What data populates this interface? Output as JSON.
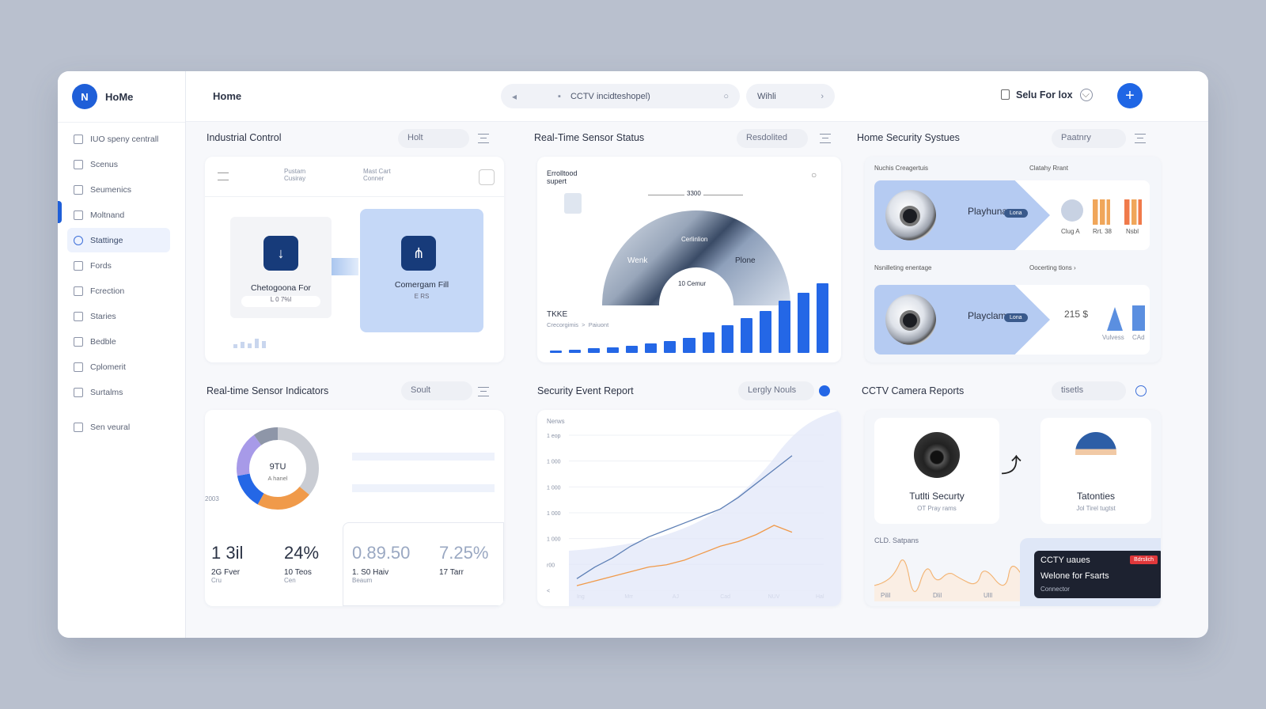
{
  "app": {
    "brand": "HoMe",
    "page_title": "Home"
  },
  "topbar": {
    "search_text": "CCTV incidteshopel)",
    "pill_text": "Wihli",
    "user_name": "Selu For lox"
  },
  "sidebar": {
    "items": [
      {
        "label": "IUO speny centrall",
        "icon": "layout-icon"
      },
      {
        "label": "Scenus",
        "icon": "list-icon"
      },
      {
        "label": "Seumenics",
        "icon": "folder-icon"
      },
      {
        "label": "Moltnand",
        "icon": "monitor-icon"
      },
      {
        "label": "Stattinge",
        "icon": "settings-icon"
      },
      {
        "label": "Fords",
        "icon": "file-icon"
      },
      {
        "label": "Fcrection",
        "icon": "grid-icon"
      },
      {
        "label": "Staries",
        "icon": "chart-icon"
      },
      {
        "label": "Bedble",
        "icon": "circle-icon"
      },
      {
        "label": "Cplomerit",
        "icon": "mail-icon"
      },
      {
        "label": "Surtalms",
        "icon": "doc-icon"
      },
      {
        "label": "Sen veural",
        "icon": "book-icon"
      }
    ]
  },
  "industrial": {
    "title": "Industrial Control",
    "pill": "Holt",
    "tab1_a": "Pustam",
    "tab1_b": "Cusiray",
    "tab2_a": "Mast Cart",
    "tab2_b": "Conner",
    "tile1_label": "Chetogoona For",
    "tile1_value": "L 0 7%l",
    "tile2_label": "Comergam Fill",
    "tile2_value": "E RS"
  },
  "sensor_status": {
    "title": "Real-Time Sensor Status",
    "pill": "Resdolited",
    "sub_a": "Errolltood",
    "sub_b": "supert",
    "gauge_top": "3300",
    "gauge_left": "Wenk",
    "gauge_right": "Plone",
    "gauge_center": "Cerlinlion",
    "gauge_inner": "10 Cemur",
    "bottom_title": "TKKE",
    "bottom_sub_a": "Crecorgimis",
    "bottom_sub_b": "Paiuont",
    "bars": [
      2,
      3,
      4,
      5,
      6,
      8,
      10,
      13,
      18,
      24,
      30,
      36,
      45,
      52,
      60
    ]
  },
  "home_security": {
    "title": "Home Security Systues",
    "pill": "Paatnry",
    "left_label": "Nuchis Creagertuis",
    "right_label": "Clatahy Rrant",
    "row1_name": "Playhuna",
    "row1_badge": "Lona",
    "thumb1": "Clug A",
    "thumb2": "Rrt. 38",
    "thumb3": "Nsbl",
    "mid_left": "Nsnilleting enentage",
    "mid_right": "Oocerting tlons",
    "row2_name": "Playclam",
    "row2_badge": "Lona",
    "stat_value": "215 $",
    "stat_sub": "",
    "thumb4": "Vulvess",
    "thumb5": "CAd"
  },
  "sensor_indicators": {
    "title": "Real-time Sensor Indicators",
    "pill": "Soult",
    "donut_value": "9TU",
    "donut_sub": "A hanel",
    "donut_axis": "2003",
    "donut_segments": [
      {
        "value": 36,
        "color": "#c9ccd3"
      },
      {
        "value": 22,
        "color": "#f09a4a"
      },
      {
        "value": 14,
        "color": "#2467e6"
      },
      {
        "value": 18,
        "color": "#a79ae8"
      },
      {
        "value": 10,
        "color": "#8e96a8"
      }
    ],
    "stats": [
      {
        "value": "1 3il",
        "label": "2G Fver",
        "sub": "Cru"
      },
      {
        "value": "24%",
        "label": "10 Teos",
        "sub": "Cen"
      },
      {
        "value": "0.89.50",
        "label": "1. S0 Haiv",
        "sub": "Beaum"
      },
      {
        "value": "7.25%",
        "label": "17 Tarr",
        "sub": ""
      }
    ]
  },
  "security_report": {
    "title": "Security Event Report",
    "pill": "Lergly Nouls",
    "y_label": "Nerws",
    "y_ticks": [
      "1 eop",
      "1 000",
      "1 000",
      "1 000",
      "1 000",
      "r00",
      "<"
    ],
    "x_ticks": [
      "Ing",
      "Mrr",
      "AJ",
      "Cad",
      "NUV",
      "Hal"
    ],
    "chart_data": {
      "type": "line",
      "x": [
        0,
        1,
        2,
        3,
        4,
        5,
        6,
        7,
        8,
        9,
        10,
        11,
        12
      ],
      "series": [
        {
          "values": [
            0.5,
            1.0,
            1.4,
            1.9,
            2.3,
            2.6,
            2.9,
            3.2,
            3.5,
            4.0,
            4.6,
            5.2,
            5.8
          ],
          "color": "#5d7fb5"
        },
        {
          "values": [
            0.2,
            0.4,
            0.6,
            0.8,
            1.0,
            1.1,
            1.3,
            1.6,
            1.9,
            2.1,
            2.4,
            2.8,
            2.5
          ],
          "color": "#f09a4a"
        }
      ]
    }
  },
  "cctv": {
    "title": "CCTV Camera Reports",
    "pill": "tisetls",
    "card1_title": "Tutlti Securty",
    "card1_sub": "OT Pray rams",
    "card2_title": "Tatonties",
    "card2_sub": "Jol Tirel tugtst",
    "chart_label": "CLD. Satpans",
    "chart_x": [
      "Pilil",
      "Dlil",
      "Ulll"
    ],
    "popup_title": "CCTY uaues",
    "popup_badge": "Bdrslich",
    "popup_text": "Welone for Fsarts",
    "popup_sub": "Connector"
  }
}
